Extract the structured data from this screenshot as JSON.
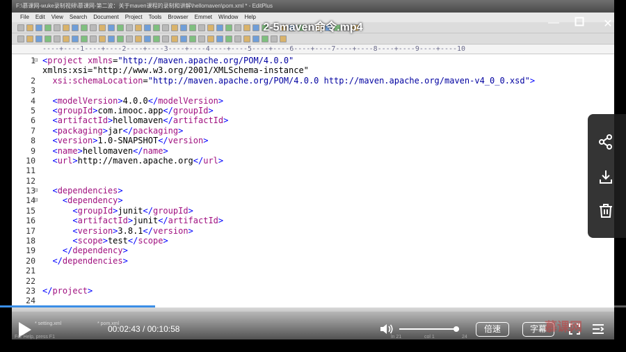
{
  "video": {
    "title": "2-5maven命令.mp4",
    "current_time": "00:02:43",
    "duration": "00:10:58",
    "time_separator": " / ",
    "progress": 0.248,
    "volume": 0.95,
    "speed_label": "倍速",
    "subtitle_label": "字幕"
  },
  "editor": {
    "window_title": "F:\\慕课网-wuke录制视频\\慕课网-第二波：关于maven课程的录制和讲解\\hellomaven\\pom.xml * - EditPlus",
    "menu": [
      "File",
      "Edit",
      "View",
      "Search",
      "Document",
      "Project",
      "Tools",
      "Browser",
      "Emmet",
      "Window",
      "Help"
    ],
    "ruler": "----+----1----+----2----+----3----+----4----+----5----+----6----+----7----+----8----+----9----+----10",
    "status": "For Help, press F1",
    "status_ln": "ln 21",
    "status_col": "col 1",
    "status_num": "24",
    "lines": [
      {
        "n": "1",
        "fold": "⊟",
        "text": "<project xmlns=\"http://maven.apache.org/POM/4.0.0\""
      },
      {
        "n": "",
        "fold": "",
        "text": "xmlns:xsi=\"http://www.w3.org/2001/XMLSchema-instance\""
      },
      {
        "n": "2",
        "fold": "",
        "text": "  xsi:schemaLocation=\"http://maven.apache.org/POM/4.0.0 http://maven.apache.org/maven-v4_0_0.xsd\">"
      },
      {
        "n": "3",
        "fold": "",
        "text": ""
      },
      {
        "n": "4",
        "fold": "",
        "text": "  <modelVersion>4.0.0</modelVersion>"
      },
      {
        "n": "5",
        "fold": "",
        "text": "  <groupId>com.imooc.app</groupId>"
      },
      {
        "n": "6",
        "fold": "",
        "text": "  <artifactId>hellomaven</artifactId>"
      },
      {
        "n": "7",
        "fold": "",
        "text": "  <packaging>jar</packaging>"
      },
      {
        "n": "8",
        "fold": "",
        "text": "  <version>1.0-SNAPSHOT</version>"
      },
      {
        "n": "9",
        "fold": "",
        "text": "  <name>hellomaven</name>"
      },
      {
        "n": "10",
        "fold": "",
        "text": "  <url>http://maven.apache.org</url>"
      },
      {
        "n": "11",
        "fold": "",
        "text": ""
      },
      {
        "n": "12",
        "fold": "",
        "text": ""
      },
      {
        "n": "13",
        "fold": "⊟",
        "text": "  <dependencies>"
      },
      {
        "n": "14",
        "fold": "⊟",
        "text": "    <dependency>"
      },
      {
        "n": "15",
        "fold": "",
        "text": "      <groupId>junit</groupId>"
      },
      {
        "n": "16",
        "fold": "",
        "text": "      <artifactId>junit</artifactId>"
      },
      {
        "n": "17",
        "fold": "",
        "text": "      <version>3.8.1</version>"
      },
      {
        "n": "18",
        "fold": "",
        "text": "      <scope>test</scope>"
      },
      {
        "n": "19",
        "fold": "",
        "text": "    </dependency>"
      },
      {
        "n": "20",
        "fold": "",
        "text": "  </dependencies>"
      },
      {
        "n": "21",
        "fold": "",
        "text": ""
      },
      {
        "n": "22",
        "fold": "",
        "text": ""
      },
      {
        "n": "23",
        "fold": "",
        "text": "</project>"
      },
      {
        "n": "24",
        "fold": "",
        "text": ""
      }
    ]
  },
  "taskbar": [
    "* setting.xml",
    "* pom.xml"
  ],
  "side_actions": [
    "share-icon",
    "download-icon",
    "delete-icon"
  ],
  "watermark": "慕课网",
  "colors": {
    "progress": "#3a8ee6",
    "tag": "#0000ff",
    "name": "#a0107f",
    "value": "#0000a0"
  }
}
